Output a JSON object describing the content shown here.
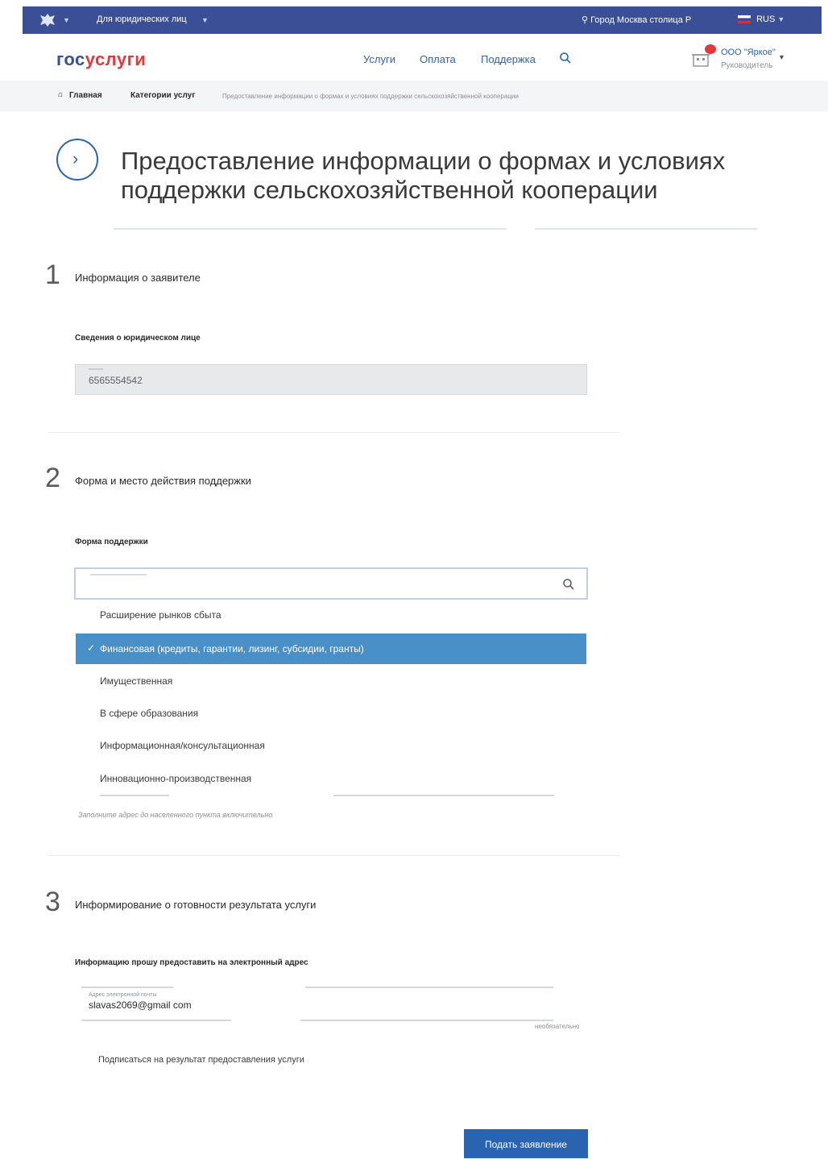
{
  "topbar": {
    "segment": "Для юридических лиц",
    "city": "Город Москва столица Р",
    "lang": "RUS"
  },
  "header": {
    "logo_part1": "гос",
    "logo_part2": "услуги",
    "nav": [
      "Услуги",
      "Оплата",
      "Поддержка"
    ],
    "org_name": "ООО \"Яркое\"",
    "org_role": "Руководитель"
  },
  "breadcrumb": [
    "Главная",
    "Категории услуг",
    "Предоставление информации о формах и условиях поддержки сельскохозяйственной кооперации"
  ],
  "page": {
    "title": "Предоставление информации о формах и условиях поддержки сельскохозяйственной кооперации"
  },
  "steps": [
    {
      "num": "1",
      "title": "Информация о заявителе"
    },
    {
      "num": "2",
      "title": "Форма и место действия поддержки"
    },
    {
      "num": "3",
      "title": "Информирование о готовности результата услуги"
    }
  ],
  "step1": {
    "label": "Сведения о юридическом лице",
    "value": "6565554542"
  },
  "step2": {
    "label": "Форма поддержки",
    "options": [
      "Расширение рынков сбыта",
      "Финансовая (кредиты, гарантии, лизинг, субсидии, гранты)",
      "Имущественная",
      "В сфере образования",
      "Информационная/консультационная",
      "Инновационно-производственная"
    ],
    "selected_index": 1,
    "hint": "Заполните адрес до населенного пункта включительно"
  },
  "step3": {
    "label": "Информацию прошу предоставить на электронный адрес",
    "email_label": "Адрес электронной почты",
    "email": "slavas2069@gmail com",
    "optional": "необязательно",
    "subscribe": "Подписаться на результат предоставления услуги"
  },
  "submit_label": "Подать заявление",
  "colors": {
    "topbar": "#3a4f96",
    "accent": "#2a64b0",
    "selected_option": "#4a90c8",
    "logo_red": "#e5383b"
  }
}
